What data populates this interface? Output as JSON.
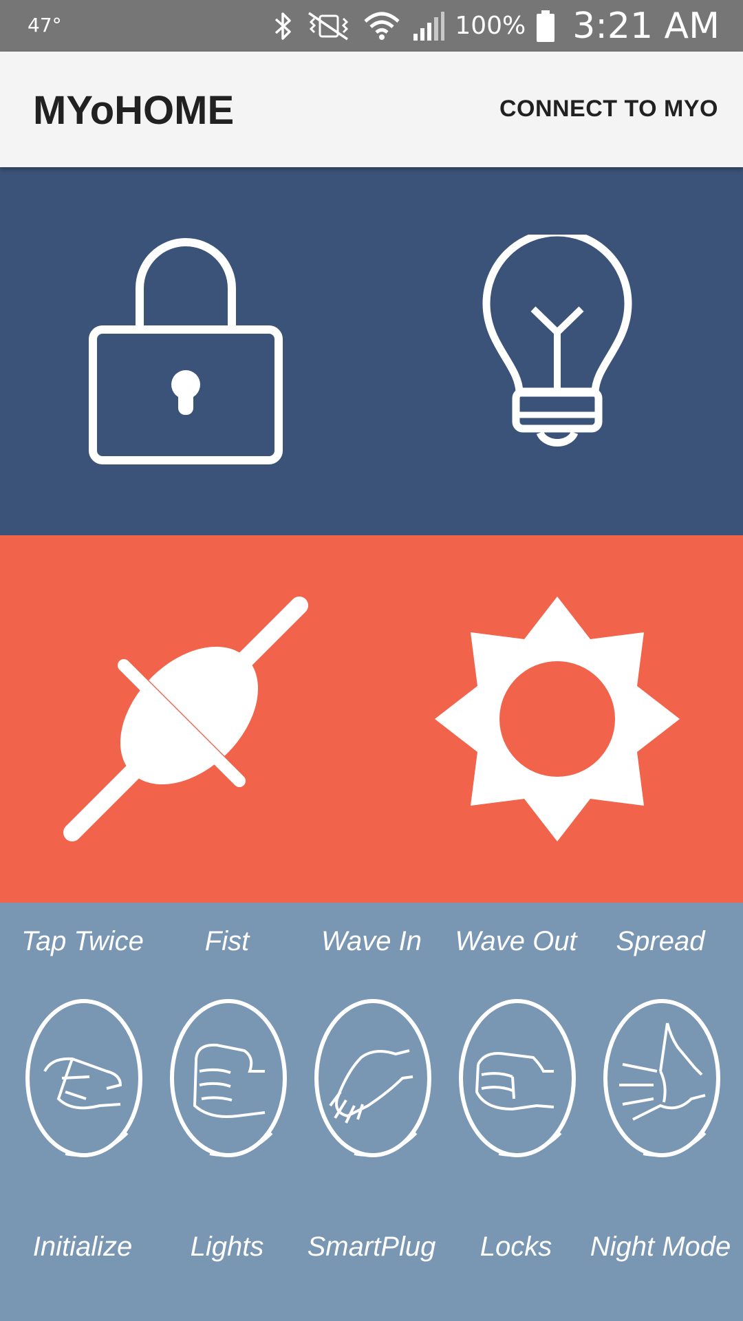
{
  "status_bar": {
    "temperature": "47°",
    "battery": "100%",
    "time": "3:21 AM",
    "icons": [
      "bluetooth-icon",
      "vibrate-icon",
      "wifi-icon",
      "signal-icon",
      "battery-icon"
    ]
  },
  "app_bar": {
    "title": "MYoHOME",
    "connect_label": "CONNECT TO MYO"
  },
  "tiles": [
    {
      "icon": "lock-icon",
      "panel": "blue"
    },
    {
      "icon": "lightbulb-icon",
      "panel": "blue"
    },
    {
      "icon": "plug-icon",
      "panel": "red"
    },
    {
      "icon": "sun-icon",
      "panel": "red"
    }
  ],
  "gestures": [
    {
      "gesture": "Tap Twice",
      "action": "Initialize",
      "icon": "tap-twice-gesture-icon"
    },
    {
      "gesture": "Fist",
      "action": "Lights",
      "icon": "fist-gesture-icon"
    },
    {
      "gesture": "Wave In",
      "action": "SmartPlug",
      "icon": "wave-in-gesture-icon"
    },
    {
      "gesture": "Wave Out",
      "action": "Locks",
      "icon": "wave-out-gesture-icon"
    },
    {
      "gesture": "Spread",
      "action": "Night Mode",
      "icon": "spread-gesture-icon"
    }
  ],
  "colors": {
    "status_bar": "#767676",
    "app_bar": "#f4f4f4",
    "blue_panel": "#3b5378",
    "red_panel": "#f2634b",
    "gesture_panel": "#7996b3"
  }
}
